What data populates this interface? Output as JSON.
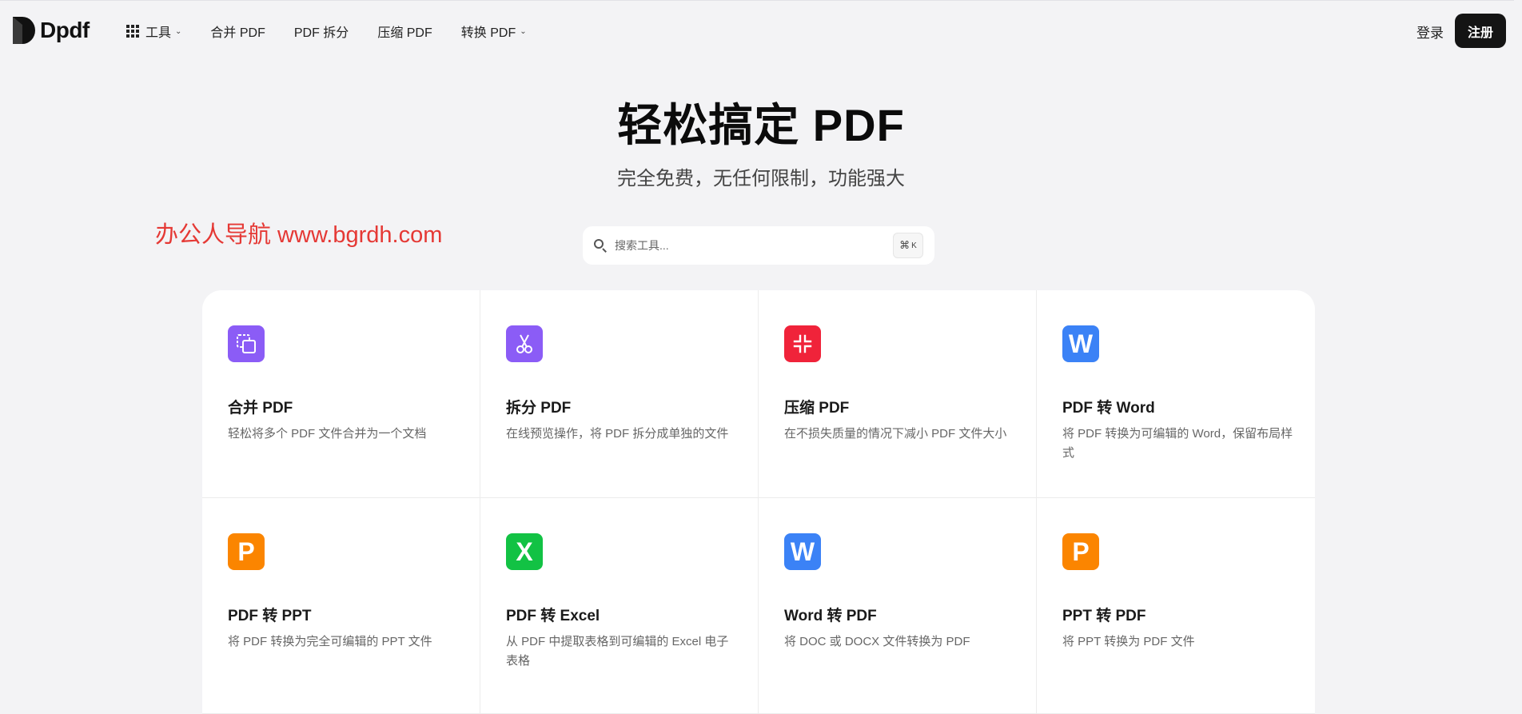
{
  "brand": {
    "name": "Dpdf"
  },
  "nav": {
    "items": [
      {
        "label": "工具",
        "icon": "grid-icon",
        "dropdown": true
      },
      {
        "label": "合并 PDF",
        "dropdown": false
      },
      {
        "label": "PDF 拆分",
        "dropdown": false
      },
      {
        "label": "压缩 PDF",
        "dropdown": false
      },
      {
        "label": "转换 PDF",
        "dropdown": true
      }
    ],
    "login": "登录",
    "signup": "注册"
  },
  "hero": {
    "title": "轻松搞定 PDF",
    "subtitle": "完全免费，无任何限制，功能强大"
  },
  "watermark": "办公人导航 www.bgrdh.com",
  "search": {
    "placeholder": "搜索工具...",
    "shortcut": "⌘",
    "shortcut_key": "K"
  },
  "cards": [
    {
      "title": "合并 PDF",
      "desc": "轻松将多个 PDF 文件合并为一个文档",
      "icon": "merge-icon",
      "color": "#8b5cf6"
    },
    {
      "title": "拆分 PDF",
      "desc": "在线预览操作，将 PDF 拆分成单独的文件",
      "icon": "scissors-icon",
      "color": "#8b5cf6"
    },
    {
      "title": "压缩 PDF",
      "desc": "在不损失质量的情况下减小 PDF 文件大小",
      "icon": "compress-icon",
      "color": "#f0233a"
    },
    {
      "title": "PDF 转 Word",
      "desc": "将 PDF 转换为可编辑的 Word，保留布局样式",
      "icon": "word-icon",
      "letter": "W",
      "color": "#3b82f6"
    },
    {
      "title": "PDF 转 PPT",
      "desc": "将 PDF 转换为完全可编辑的 PPT 文件",
      "icon": "ppt-icon",
      "letter": "P",
      "color": "#fb8500"
    },
    {
      "title": "PDF 转 Excel",
      "desc": "从 PDF 中提取表格到可编辑的 Excel 电子表格",
      "icon": "excel-icon",
      "letter": "X",
      "color": "#12c244"
    },
    {
      "title": "Word 转 PDF",
      "desc": "将 DOC 或 DOCX 文件转换为 PDF",
      "icon": "word-icon",
      "letter": "W",
      "color": "#3b82f6"
    },
    {
      "title": "PPT 转 PDF",
      "desc": "将 PPT 转换为 PDF 文件",
      "icon": "ppt-icon",
      "letter": "P",
      "color": "#fb8500"
    }
  ]
}
